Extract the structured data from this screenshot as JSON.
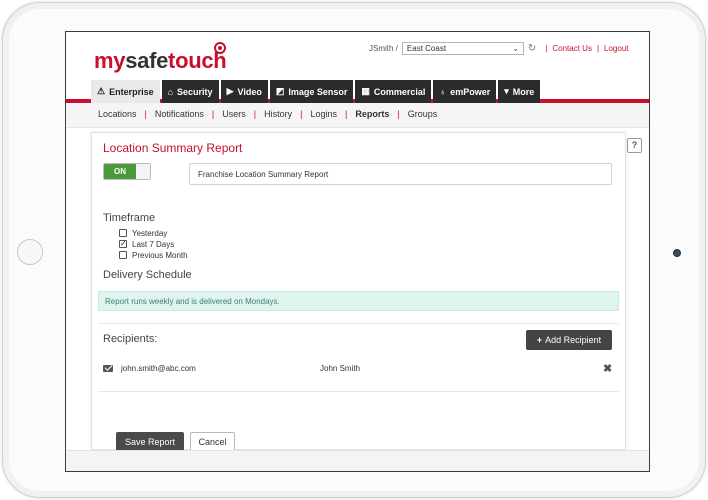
{
  "header": {
    "logo": {
      "my": "my",
      "safe": "safe",
      "touch": "touch"
    },
    "user": "JSmith /",
    "location": "East Coast",
    "contact_label": "Contact Us",
    "logout_label": "Logout"
  },
  "mainnav": [
    {
      "label": "Enterprise",
      "icon": "enterprise-icon",
      "glyph": "⚠"
    },
    {
      "label": "Security",
      "icon": "home-icon",
      "glyph": "⌂"
    },
    {
      "label": "Video",
      "icon": "video-icon",
      "glyph": "▶"
    },
    {
      "label": "Image Sensor",
      "icon": "camera-icon",
      "glyph": "◩"
    },
    {
      "label": "Commercial",
      "icon": "building-icon",
      "glyph": "▦"
    },
    {
      "label": "emPower",
      "icon": "bulb-icon",
      "glyph": "♁"
    },
    {
      "label": "More",
      "icon": "caret-down-icon",
      "glyph": "▾"
    }
  ],
  "subnav": [
    "Locations",
    "Notifications",
    "Users",
    "History",
    "Logins",
    "Reports",
    "Groups"
  ],
  "report": {
    "title": "Location Summary Report",
    "toggle_label": "ON",
    "name_value": "Franchise Location Summary Report",
    "timeframe_title": "Timeframe",
    "timeframe_options": [
      {
        "label": "Yesterday",
        "checked": false
      },
      {
        "label": "Last 7 Days",
        "checked": true
      },
      {
        "label": "Previous Month",
        "checked": false
      }
    ],
    "delivery_title": "Delivery Schedule",
    "delivery_info": "Report runs weekly and is delivered on Mondays.",
    "recipients_title": "Recipients:",
    "add_recipient_label": "Add Recipient",
    "recipients": [
      {
        "email": "john.smith@abc.com",
        "name": "John Smith"
      }
    ],
    "save_label": "Save Report",
    "cancel_label": "Cancel"
  },
  "help_label": "?"
}
